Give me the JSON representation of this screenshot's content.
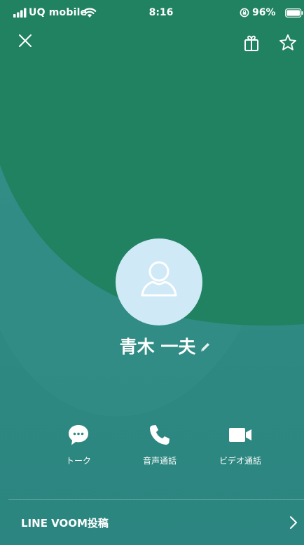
{
  "status_bar": {
    "carrier": "UQ mobile",
    "time": "8:16",
    "battery_percent": "96%",
    "icons": [
      "signal-bars-icon",
      "wifi-icon",
      "rotation-lock-icon",
      "battery-icon"
    ]
  },
  "top_bar": {
    "icons": [
      "close-icon",
      "gift-icon",
      "star-icon"
    ]
  },
  "profile": {
    "name": "青木 一夫",
    "avatar_icon": "person-silhouette-icon",
    "edit_icon": "pencil-icon"
  },
  "actions": [
    {
      "label": "トーク",
      "icon": "chat-bubble-icon"
    },
    {
      "label": "音声通話",
      "icon": "phone-icon"
    },
    {
      "label": "ビデオ通話",
      "icon": "video-camera-icon"
    }
  ],
  "bottom": {
    "voom_label": "LINE VOOM投稿",
    "chevron_icon": "chevron-right-icon"
  },
  "colors": {
    "background_teal": "#2f8a80",
    "background_green": "#208260",
    "avatar_bg": "#cfe9f7",
    "text": "#ffffff"
  }
}
